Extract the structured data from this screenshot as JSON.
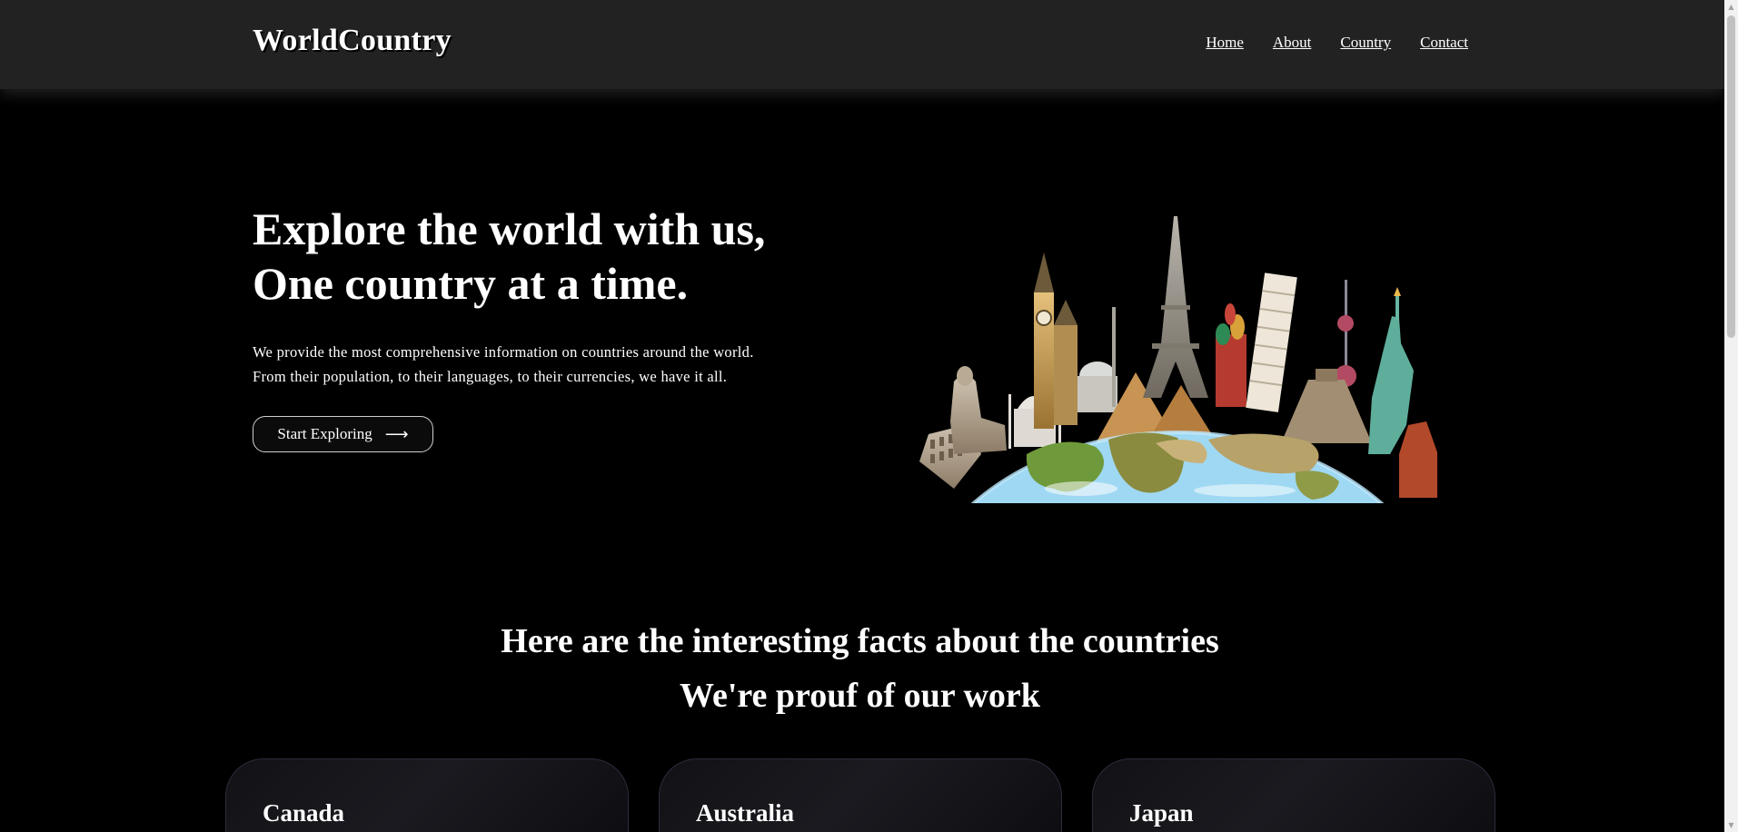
{
  "header": {
    "logo": "WorldCountry",
    "nav": [
      "Home",
      "About",
      "Country",
      "Contact"
    ]
  },
  "hero": {
    "title_line1": "Explore the world with us,",
    "title_line2": "One country at a time.",
    "desc_line1": "We provide the most comprehensive information on countries around the world.",
    "desc_line2": "From their population, to their languages, to their currencies, we have it all.",
    "cta_label": "Start Exploring",
    "cta_icon": "arrow-right-icon",
    "image": "world-landmarks-globe-illustration"
  },
  "facts": {
    "line1": "Here are the interesting facts about the countries",
    "line2": "We're prouf of our work"
  },
  "cards": [
    {
      "title": "Canada"
    },
    {
      "title": "Australia"
    },
    {
      "title": "Japan"
    }
  ],
  "colors": {
    "background": "#000000",
    "header": "#222222",
    "text": "#ffffff"
  }
}
